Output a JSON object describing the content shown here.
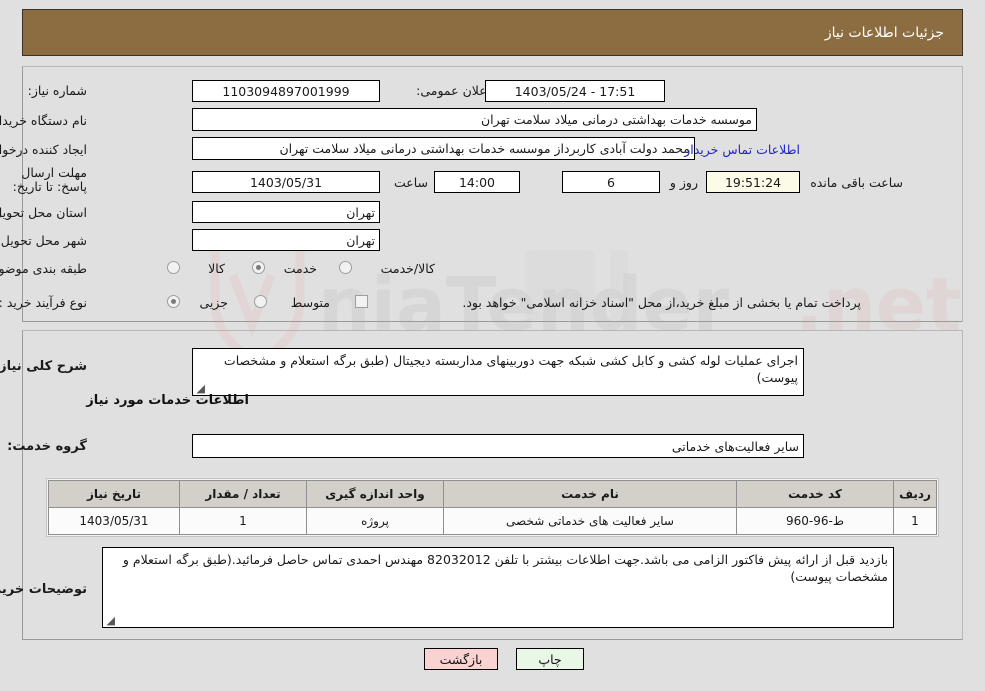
{
  "header": {
    "title": "جزئیات اطلاعات نیاز"
  },
  "top_form": {
    "need_number_label": "شماره نیاز:",
    "need_number_value": "1103094897001999",
    "public_announce_label": "تاریخ و ساعت اعلان عمومی:",
    "public_announce_value": "17:51 - 1403/05/24",
    "buyer_org_label": "نام دستگاه خریدار:",
    "buyer_org_value": "موسسه خدمات بهداشتی درمانی میلاد سلامت تهران",
    "creator_label": "ایجاد کننده درخواست:",
    "creator_value": "محمد دولت آبادی کاربرداز موسسه خدمات بهداشتی درمانی میلاد سلامت تهران",
    "contact_link": "اطلاعات تماس خریدار",
    "deadline_label": "مهلت ارسال پاسخ: تا تاریخ:",
    "deadline_date": "1403/05/31",
    "deadline_hour_label": "ساعت",
    "deadline_time": "14:00",
    "remaining_days": "6",
    "remaining_days_label": "روز و",
    "remaining_timer": "19:51:24",
    "remaining_suffix_label": "ساعت باقی مانده",
    "province_label": "استان محل تحویل:",
    "province_value": "تهران",
    "city_label": "شهر محل تحویل:",
    "city_value": "تهران",
    "category_label": "طبقه بندی موضوعی:",
    "category_options": [
      "کالا",
      "خدمت",
      "کالا/خدمت"
    ],
    "category_selected": "خدمت",
    "process_label": "نوع فرآیند خرید :",
    "process_options": [
      "جزیی",
      "متوسط"
    ],
    "process_selected": "جزیی",
    "treasury_checkbox_text": "پرداخت تمام یا بخشی از مبلغ خرید،از محل \"اسناد خزانه اسلامی\" خواهد بود.",
    "treasury_checked": false
  },
  "main": {
    "summary_label": "شرح کلی نیاز:",
    "summary_value": "اجرای عملیات لوله کشی و کابل کشی شبکه جهت دوربینهای مداربسته دیجیتال (طبق برگه استعلام و مشخصات پیوست)",
    "services_heading": "اطلاعات خدمات مورد نیاز",
    "service_group_label": "گروه خدمت:",
    "service_group_value": "سایر فعالیت‌های خدماتی",
    "table": {
      "columns": [
        "ردیف",
        "کد خدمت",
        "نام خدمت",
        "واحد اندازه گیری",
        "تعداد / مقدار",
        "تاریخ نیاز"
      ],
      "rows": [
        [
          "1",
          "ط-96-960",
          "سایر فعالیت های خدماتی شخصی",
          "پروژه",
          "1",
          "1403/05/31"
        ]
      ]
    },
    "buyer_notes_label": "توضیحات خریدار:",
    "buyer_notes_value": "بازدید قبل از ارائه پیش فاکتور الزامی می باشد.جهت اطلاعات بیشتر با تلفن 82032012 مهندس احمدی تماس حاصل فرمائید.(طبق برگه استعلام و مشخصات پیوست)"
  },
  "footer": {
    "print_label": "چاپ",
    "back_label": "بازگشت"
  },
  "colors": {
    "header_bg": "#8c6d42",
    "page_bg": "#e0e0e0",
    "link": "#2222cc",
    "timer_bg": "#fbfbe8",
    "print_btn_bg": "#e9f7e6",
    "back_btn_bg": "#fbd2d2",
    "table_header_bg": "#d3d0c9"
  }
}
